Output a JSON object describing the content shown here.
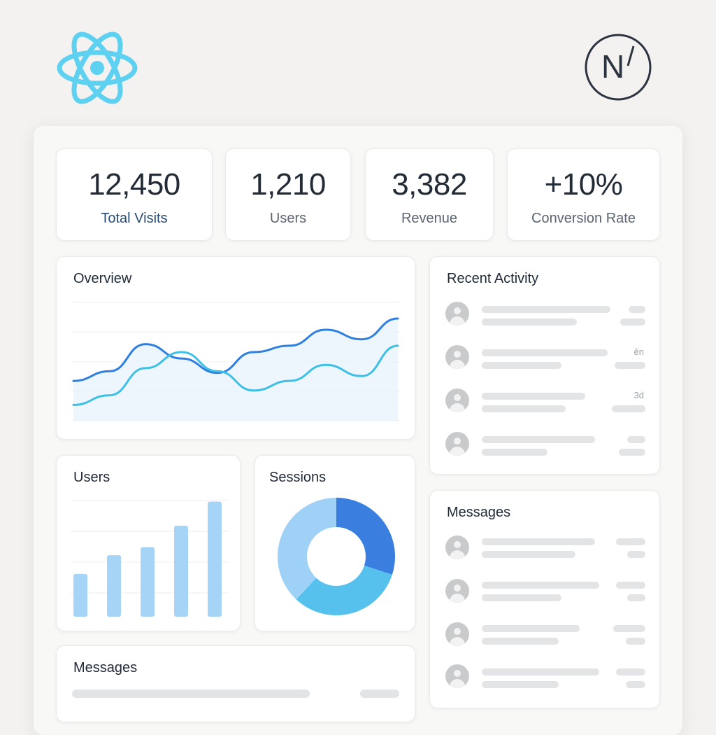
{
  "logos": {
    "left": "react-logo",
    "right": "next-logo",
    "right_letter": "N"
  },
  "stats": [
    {
      "value": "12,450",
      "label": "Total Visits"
    },
    {
      "value": "1,210",
      "label": "Users"
    },
    {
      "value": "3,382",
      "label": "Revenue"
    },
    {
      "value": "+10%",
      "label": "Conversion Rate"
    }
  ],
  "overview": {
    "title": "Overview",
    "chart_data": {
      "type": "line",
      "x": [
        0,
        1,
        2,
        3,
        4,
        5,
        6,
        7,
        8,
        9,
        10
      ],
      "series": [
        {
          "values": [
            2.4,
            3.0,
            4.7,
            3.8,
            2.9,
            4.2,
            4.6,
            5.6,
            5.0,
            6.3
          ]
        },
        {
          "values": [
            0.9,
            1.5,
            3.2,
            4.2,
            3.0,
            1.8,
            2.4,
            3.4,
            2.7,
            4.6
          ]
        }
      ],
      "colors": [
        "#2f7fe0",
        "#3ec0e6"
      ]
    }
  },
  "recent_activity": {
    "title": "Recent Activity",
    "times": [
      "",
      "ên",
      "3d",
      ""
    ]
  },
  "users": {
    "title": "Users",
    "chart_data": {
      "type": "bar",
      "values": [
        3.2,
        4.6,
        5.2,
        6.8,
        8.6
      ],
      "ylim": [
        0,
        9
      ]
    }
  },
  "sessions": {
    "title": "Sessions",
    "chart_data": {
      "type": "pie",
      "values": [
        30,
        32,
        38
      ],
      "colors": [
        "#3a7fe0",
        "#55c1ec",
        "#9fd1f7"
      ]
    }
  },
  "messages_right": {
    "title": "Messages"
  },
  "messages_bottom": {
    "title": "Messages"
  }
}
